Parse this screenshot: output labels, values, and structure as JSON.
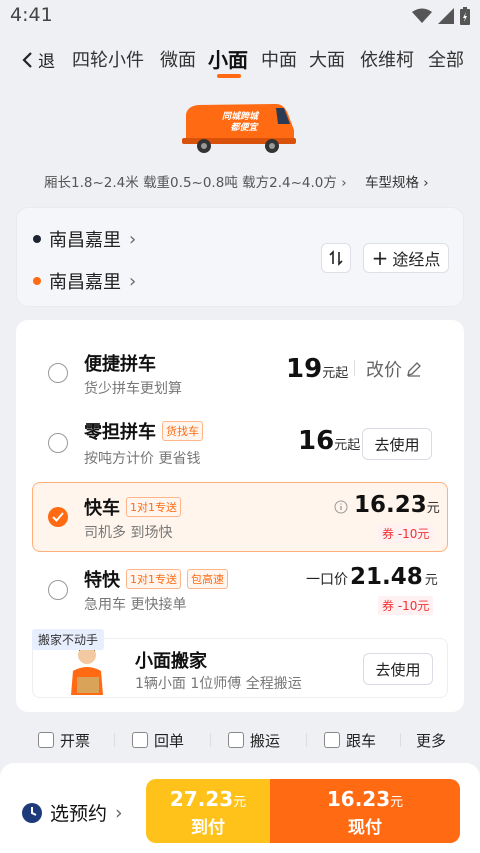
{
  "status_bar": {
    "time": "4:41"
  },
  "header": {
    "back_label": "退",
    "tabs": [
      "四轮小件",
      "微面",
      "小面",
      "中面",
      "大面",
      "依维柯",
      "全部"
    ],
    "active_tab": "小面"
  },
  "van": {
    "slogan_line1": "同城跨城",
    "slogan_line2": "都便宜",
    "body_color": "#ff6a13"
  },
  "specs": {
    "length": "厢长1.8~2.4米",
    "load": "载重0.5~0.8吨",
    "volume": "载方2.4~4.0方",
    "spec_link": "车型规格"
  },
  "route": {
    "from": "南昌嘉里",
    "to": "南昌嘉里",
    "waypoint_label": "途经点"
  },
  "options": [
    {
      "title": "便捷拼车",
      "subtitle": "货少拼车更划算",
      "price": "19",
      "price_unit": "元起",
      "action": "改价"
    },
    {
      "title": "零担拼车",
      "tag": "货找车",
      "subtitle": "按吨方计价 更省钱",
      "price": "16",
      "price_unit": "元起",
      "action": "去使用"
    },
    {
      "title": "快车",
      "tag": "1对1专送",
      "subtitle": "司机多 到场快",
      "price": "16.23",
      "price_unit": "元",
      "coupon": "券 -10元"
    },
    {
      "title": "特快",
      "tags": [
        "1对1专送",
        "包高速"
      ],
      "subtitle": "急用车 更快接单",
      "price_prefix": "一口价",
      "price": "21.48",
      "price_unit": "元",
      "coupon": "券 -10元"
    }
  ],
  "moving": {
    "badge": "搬家不动手",
    "title": "小面搬家",
    "subtitle": "1辆小面 1位师傅 全程搬运",
    "action": "去使用"
  },
  "extras": [
    "开票",
    "回单",
    "搬运",
    "跟车"
  ],
  "extras_more": "更多",
  "bottom": {
    "schedule_label": "选预约",
    "pay_on_arrival_amount": "27.23",
    "pay_on_arrival_unit": "元",
    "pay_on_arrival_label": "到付",
    "pay_now_amount": "16.23",
    "pay_now_unit": "元",
    "pay_now_label": "现付"
  },
  "colors": {
    "accent": "#ff6a13",
    "yellow": "#ffc21a",
    "coupon_red": "#e33333"
  }
}
